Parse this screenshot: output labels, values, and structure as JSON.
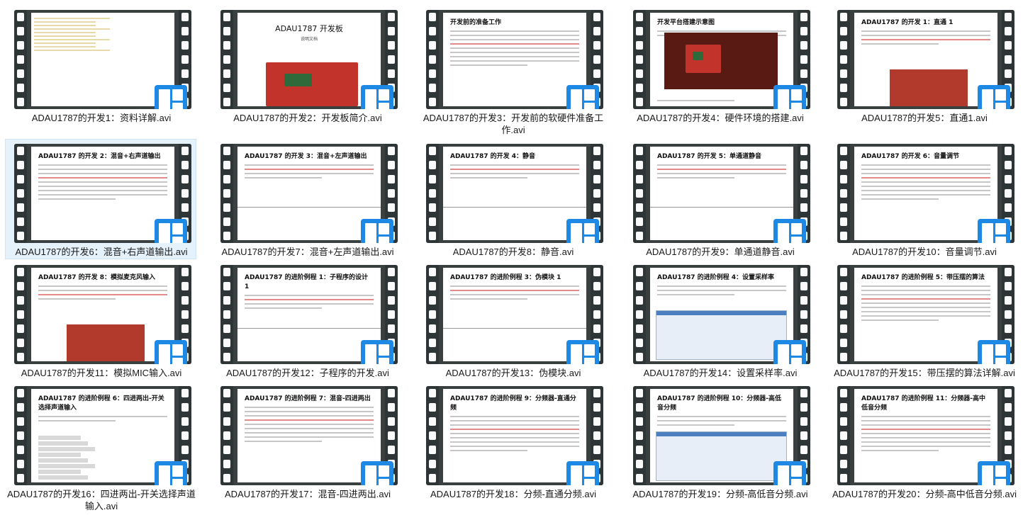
{
  "files": [
    {
      "name": "ADAU1787的开发1：资料详解.avi",
      "preview": {
        "kind": "explorer"
      }
    },
    {
      "name": "ADAU1787的开发2：开发板简介.avi",
      "preview": {
        "kind": "cover",
        "title": "ADAU1787 开发板",
        "subtitle": "说明文档"
      }
    },
    {
      "name": "ADAU1787的开发3：开发前的软硬件准备工作.avi",
      "preview": {
        "kind": "doc",
        "title": "开发前的准备工作"
      }
    },
    {
      "name": "ADAU1787的开发4：硬件环境的搭建.avi",
      "preview": {
        "kind": "photo",
        "title": "开发平台搭建示意图"
      }
    },
    {
      "name": "ADAU1787的开发5：直通1.avi",
      "preview": {
        "kind": "doc-photo",
        "title": "ADAU1787 的开发 1：直通 1"
      }
    },
    {
      "name": "ADAU1787的开发6：混音+右声道输出.avi",
      "preview": {
        "kind": "doc",
        "title": "ADAU1787 的开发 2：混音+右声道输出"
      }
    },
    {
      "name": "ADAU1787的开发7：混音+左声道输出.avi",
      "preview": {
        "kind": "doc-rule",
        "title": "ADAU1787 的开发 3：混音+左声道输出"
      }
    },
    {
      "name": "ADAU1787的开发8：静音.avi",
      "preview": {
        "kind": "doc-rule",
        "title": "ADAU1787 的开发 4：静音"
      }
    },
    {
      "name": "ADAU1787的开发9：单通道静音.avi",
      "preview": {
        "kind": "doc-rule",
        "title": "ADAU1787 的开发 5：单通道静音"
      }
    },
    {
      "name": "ADAU1787的开发10：音量调节.avi",
      "preview": {
        "kind": "doc",
        "title": "ADAU1787 的开发 6：音量调节"
      }
    },
    {
      "name": "ADAU1787的开发11：模拟MIC输入.avi",
      "preview": {
        "kind": "doc-photo",
        "title": "ADAU1787 的开发 8：模拟麦克风输入"
      }
    },
    {
      "name": "ADAU1787的开发12：子程序的开发.avi",
      "preview": {
        "kind": "doc-rule",
        "title": "ADAU1787 的进阶例程 1：子程序的设计 1"
      }
    },
    {
      "name": "ADAU1787的开发13：伪模块.avi",
      "preview": {
        "kind": "doc-rule",
        "title": "ADAU1787 的进阶例程 3：伪模块 1"
      }
    },
    {
      "name": "ADAU1787的开发14：设置采样率.avi",
      "preview": {
        "kind": "doc-app",
        "title": "ADAU1787 的进阶例程 4：设置采样率"
      }
    },
    {
      "name": "ADAU1787的开发15：带压摆的算法详解.avi",
      "preview": {
        "kind": "doc",
        "title": "ADAU1787 的进阶例程 5：带压摆的算法"
      }
    },
    {
      "name": "ADAU1787的开发16：四进两出-开关选择声道输入.avi",
      "preview": {
        "kind": "doc-tree",
        "title": "ADAU1787 的进阶例程 6：四进两出-开关选择声道输入"
      }
    },
    {
      "name": "ADAU1787的开发17：混音-四进两出.avi",
      "preview": {
        "kind": "doc",
        "title": "ADAU1787 的进阶例程 7：混音-四进两出"
      }
    },
    {
      "name": "ADAU1787的开发18：分频-直通分频.avi",
      "preview": {
        "kind": "doc",
        "title": "ADAU1787 的进阶例程 9：分频器-直通分频"
      }
    },
    {
      "name": "ADAU1787的开发19：分频-高低音分频.avi",
      "preview": {
        "kind": "doc-app",
        "title": "ADAU1787 的进阶例程 10：分频器-高低音分频"
      }
    },
    {
      "name": "ADAU1787的开发20：分频-高中低音分频.avi",
      "preview": {
        "kind": "doc",
        "title": "ADAU1787 的进阶例程 11：分频器-高中低音分频"
      }
    }
  ],
  "selected_index": 5,
  "colors": {
    "badge": "#1e88e5",
    "selection_bg": "#e5f1fb",
    "filmstrip": "#2e3536"
  },
  "icons": {
    "badge": "video-file-type-icon"
  }
}
